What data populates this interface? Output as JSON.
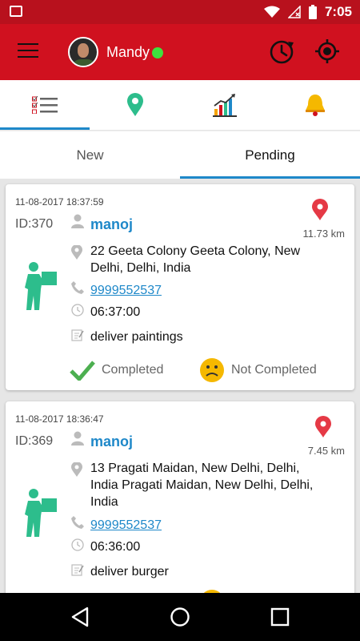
{
  "status_bar": {
    "time": "7:05"
  },
  "header": {
    "user_name": "Mandy"
  },
  "icon_tabs": [
    {
      "name": "orders",
      "icon": "checklist-icon"
    },
    {
      "name": "map",
      "icon": "map-pin-icon"
    },
    {
      "name": "stats",
      "icon": "chart-icon"
    },
    {
      "name": "notifications",
      "icon": "bell-icon"
    }
  ],
  "tabs": {
    "new_label": "New",
    "pending_label": "Pending"
  },
  "orders": [
    {
      "date": "11-08-2017 18:37:59",
      "id": "ID:370",
      "customer": "manoj",
      "address": "22 Geeta Colony Geeta Colony, New Delhi, Delhi, India",
      "phone": "9999552537",
      "time": "06:37:00",
      "note": "deliver paintings",
      "distance": "11.73 km",
      "completed_label": "Completed",
      "not_completed_label": "Not Completed"
    },
    {
      "date": "11-08-2017 18:36:47",
      "id": "ID:369",
      "customer": "manoj",
      "address": "13 Pragati Maidan, New Delhi, Delhi, India Pragati Maidan, New Delhi, Delhi, India",
      "phone": "9999552537",
      "time": "06:36:00",
      "note": "deliver burger",
      "distance": "7.45 km"
    }
  ],
  "colors": {
    "primary": "#d0111f",
    "status": "#b8111d",
    "accent": "#1e88c9",
    "online": "#3ee13e",
    "courier": "#2dbd8c",
    "check": "#4caf50",
    "sad": "#f5b800"
  }
}
